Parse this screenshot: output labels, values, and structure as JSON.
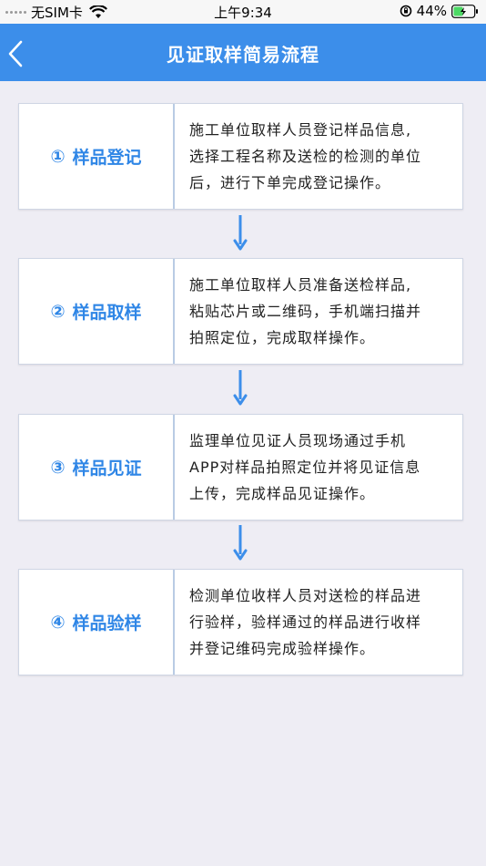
{
  "status_bar": {
    "carrier": "无SIM卡",
    "time": "上午9:34",
    "battery": "44%"
  },
  "nav": {
    "title": "见证取样简易流程"
  },
  "colors": {
    "accent": "#3c8eea",
    "step_title": "#2f86e6",
    "arrow": "#3c8eea"
  },
  "steps": [
    {
      "num": "①",
      "title": "样品登记",
      "lines": [
        "施工单位取样人员登记样品信息,",
        "选择工程名称及送检的检测的单位",
        "后，进行下单完成登记操作。"
      ]
    },
    {
      "num": "②",
      "title": "样品取样",
      "lines": [
        "施工单位取样人员准备送检样品,",
        "粘贴芯片或二维码，手机端扫描并",
        "拍照定位，完成取样操作。"
      ]
    },
    {
      "num": "③",
      "title": "样品见证",
      "lines": [
        "监理单位见证人员现场通过手机",
        "APP对样品拍照定位并将见证信息",
        "上传，完成样品见证操作。"
      ]
    },
    {
      "num": "④",
      "title": "样品验样",
      "lines": [
        "检测单位收样人员对送检的样品进",
        "行验样，验样通过的样品进行收样",
        "并登记维码完成验样操作。"
      ]
    }
  ]
}
